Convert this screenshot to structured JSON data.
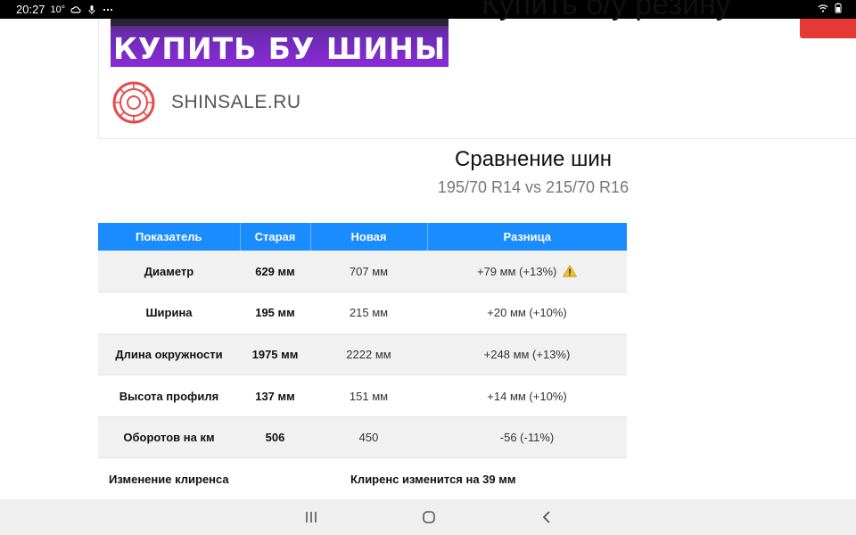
{
  "status_bar": {
    "time": "20:27",
    "temperature": "10°",
    "icons_left": [
      "cloud-icon",
      "mic-icon",
      "more-dots-icon"
    ],
    "icons_right": [
      "wifi-icon",
      "battery-icon"
    ]
  },
  "ad": {
    "banner_text": "КУПИТЬ БУ ШИНЫ",
    "headline": "Купить б/у резину",
    "domain": "SHINSALE.RU",
    "logo_icon": "tire-icon",
    "banner_color": "#8a2bd6",
    "button_color": "#e53935"
  },
  "heading": {
    "title": "Сравнение шин",
    "subtitle": "195/70 R14 vs 215/70 R16"
  },
  "table": {
    "header_color": "#1a8cff",
    "headers": [
      "Показатель",
      "Старая",
      "Новая",
      "Разница"
    ],
    "rows": [
      {
        "metric": "Диаметр",
        "old": "629 мм",
        "new": "707 мм",
        "diff": "+79 мм (+13%)",
        "warning": true
      },
      {
        "metric": "Ширина",
        "old": "195 мм",
        "new": "215 мм",
        "diff": "+20 мм (+10%)",
        "warning": false
      },
      {
        "metric": "Длина окружности",
        "old": "1975 мм",
        "new": "2222 мм",
        "diff": "+248 мм (+13%)",
        "warning": false
      },
      {
        "metric": "Высота профиля",
        "old": "137 мм",
        "new": "151 мм",
        "diff": "+14 мм (+10%)",
        "warning": false
      },
      {
        "metric": "Оборотов на км",
        "old": "506",
        "new": "450",
        "diff": "-56 (-11%)",
        "warning": false
      }
    ],
    "clearance_label": "Изменение клиренса",
    "clearance_value": "Клиренс изменится на 39 мм"
  },
  "nav_bar": {
    "buttons": [
      "recent-apps-icon",
      "home-icon",
      "back-icon"
    ]
  }
}
